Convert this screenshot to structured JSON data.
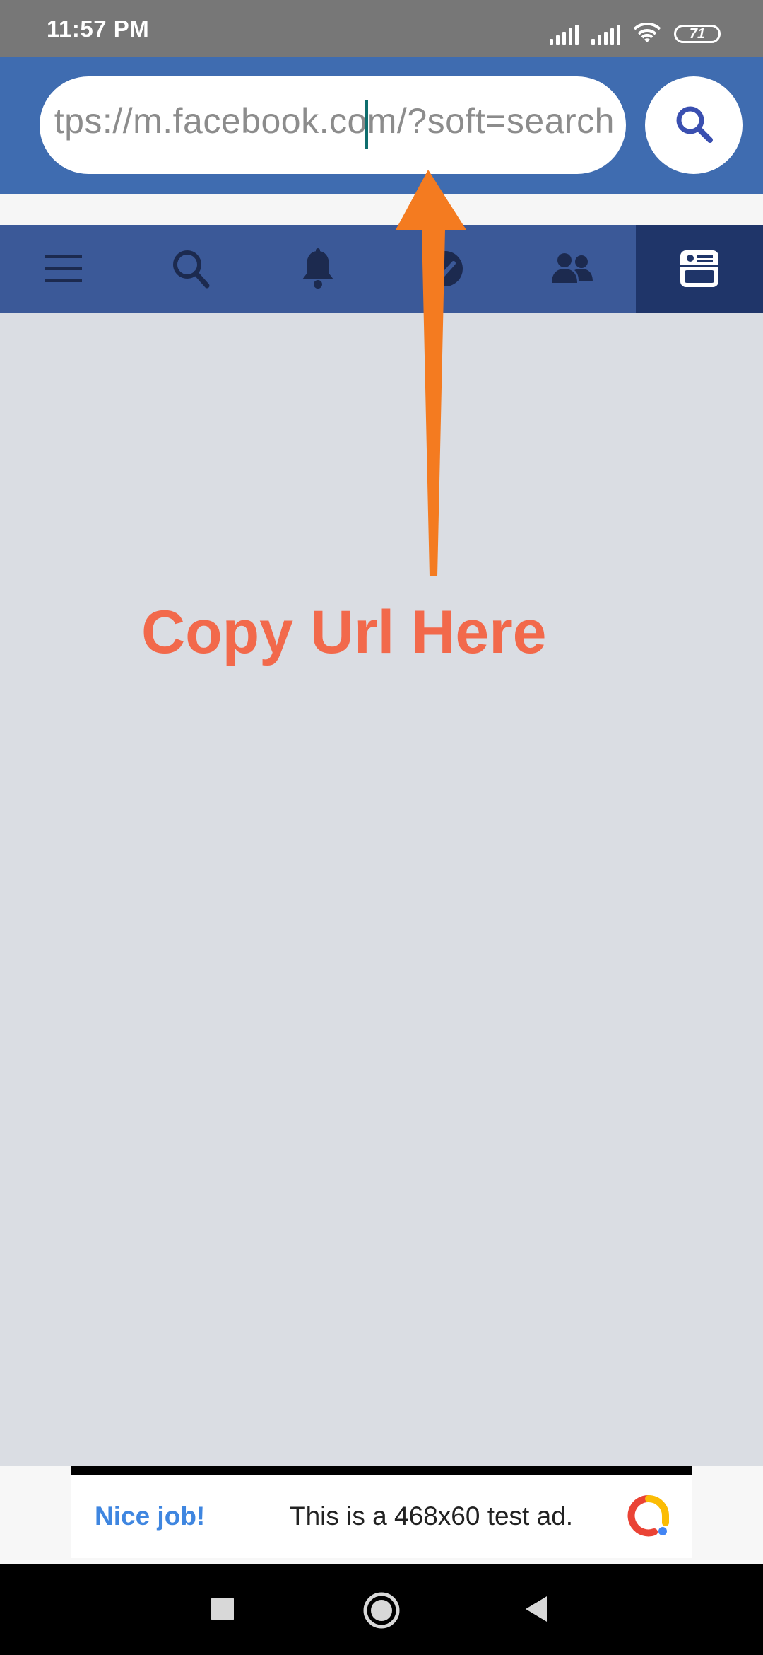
{
  "status_bar": {
    "time": "11:57 PM",
    "battery": "71",
    "icons": [
      "signal-icon",
      "signal-icon",
      "wifi-icon",
      "battery-icon"
    ]
  },
  "url_bar": {
    "url_value": "tps://m.facebook.com/?soft=search",
    "search_icon": "search-icon"
  },
  "fb_nav": {
    "items": [
      {
        "name": "menu-icon"
      },
      {
        "name": "search-icon"
      },
      {
        "name": "bell-icon"
      },
      {
        "name": "messenger-icon"
      },
      {
        "name": "friends-icon"
      },
      {
        "name": "news-feed-icon",
        "active": true
      }
    ],
    "accent_color": "#3b5998"
  },
  "annotation": {
    "text": "Copy Url Here",
    "color": "#f2694b",
    "arrow_color": "#f47b20"
  },
  "ad": {
    "nice_label": "Nice job!",
    "text": "This is a 468x60 test ad."
  },
  "nav_bar": {
    "buttons": [
      "recents-icon",
      "home-icon",
      "back-icon"
    ]
  }
}
